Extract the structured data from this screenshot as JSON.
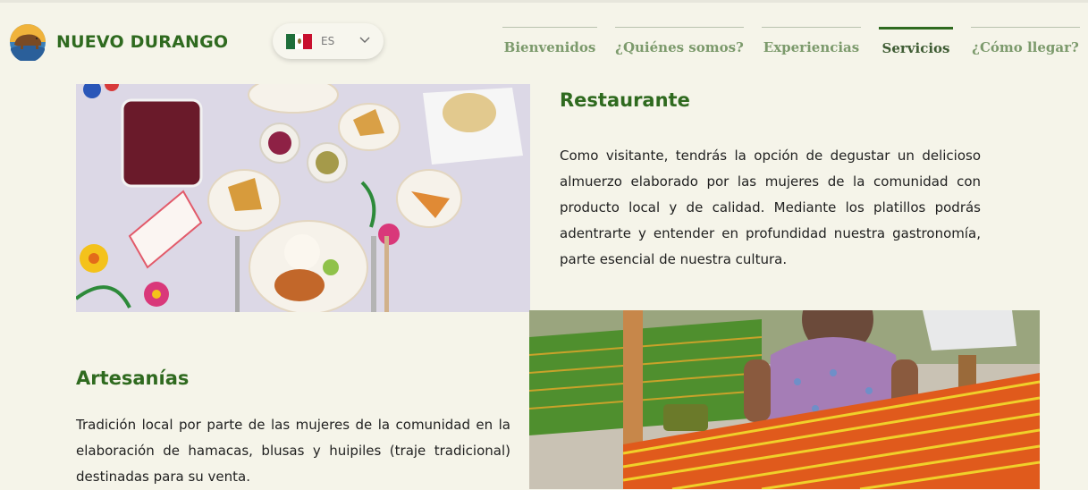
{
  "header": {
    "logo_text": "NUEVO DURANGO",
    "language": {
      "code": "ES",
      "flag": "mexico-flag"
    },
    "nav": [
      {
        "label": "Bienvenidos",
        "active": false
      },
      {
        "label": "¿Quiénes somos?",
        "active": false
      },
      {
        "label": "Experiencias",
        "active": false
      },
      {
        "label": "Servicios",
        "active": true
      },
      {
        "label": "¿Cómo llegar?",
        "active": false
      }
    ]
  },
  "sections": {
    "restaurante": {
      "title": "Restaurante",
      "text": "Como visitante, tendrás la opción de degustar un delicioso almuerzo elaborado por las mujeres de la comunidad con producto local y de calidad. Mediante los platillos podrás adentrarte y entender en profundidad nuestra gastronomía, parte esencial de nuestra cultura."
    },
    "artesanias": {
      "title": "Artesanías",
      "text": "Tradición local por parte de las mujeres de la comunidad en la elaboración de hamacas, blusas y huipiles (traje tradicional) destinadas para su venta."
    }
  },
  "colors": {
    "background": "#f5f4e9",
    "brand_green": "#2f6a1f",
    "nav_text": "#7c9a6c"
  }
}
